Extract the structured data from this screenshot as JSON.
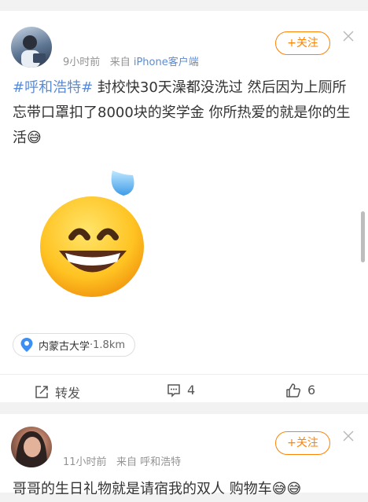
{
  "post1": {
    "time": "9小时前",
    "source_prefix": "来自",
    "source": "iPhone客户端",
    "follow_label": "+关注",
    "hashtag": "#呼和浩特#",
    "body": " 封校快30天澡都没洗过  然后因为上厕所忘带口罩扣了8000块的奖学金  你所热爱的就是你的生活😅",
    "location": "内蒙古大学",
    "distance": "·1.8km",
    "actions": {
      "repost_label": "转发",
      "comment_count": "4",
      "like_count": "6"
    }
  },
  "post2": {
    "time": "11小时前",
    "source_prefix": "来自",
    "source": "呼和浩特",
    "follow_label": "+关注",
    "body_partial": "哥哥的生日礼物就是请宿我的双人 购物车😅😅"
  },
  "colors": {
    "accent_orange": "#ff8200",
    "link_blue": "#5a8bd6",
    "meta_gray": "#939393"
  },
  "icons": [
    "close-icon",
    "location-pin-icon",
    "repost-icon",
    "comment-icon",
    "like-icon",
    "sweat-smile-emoji"
  ]
}
